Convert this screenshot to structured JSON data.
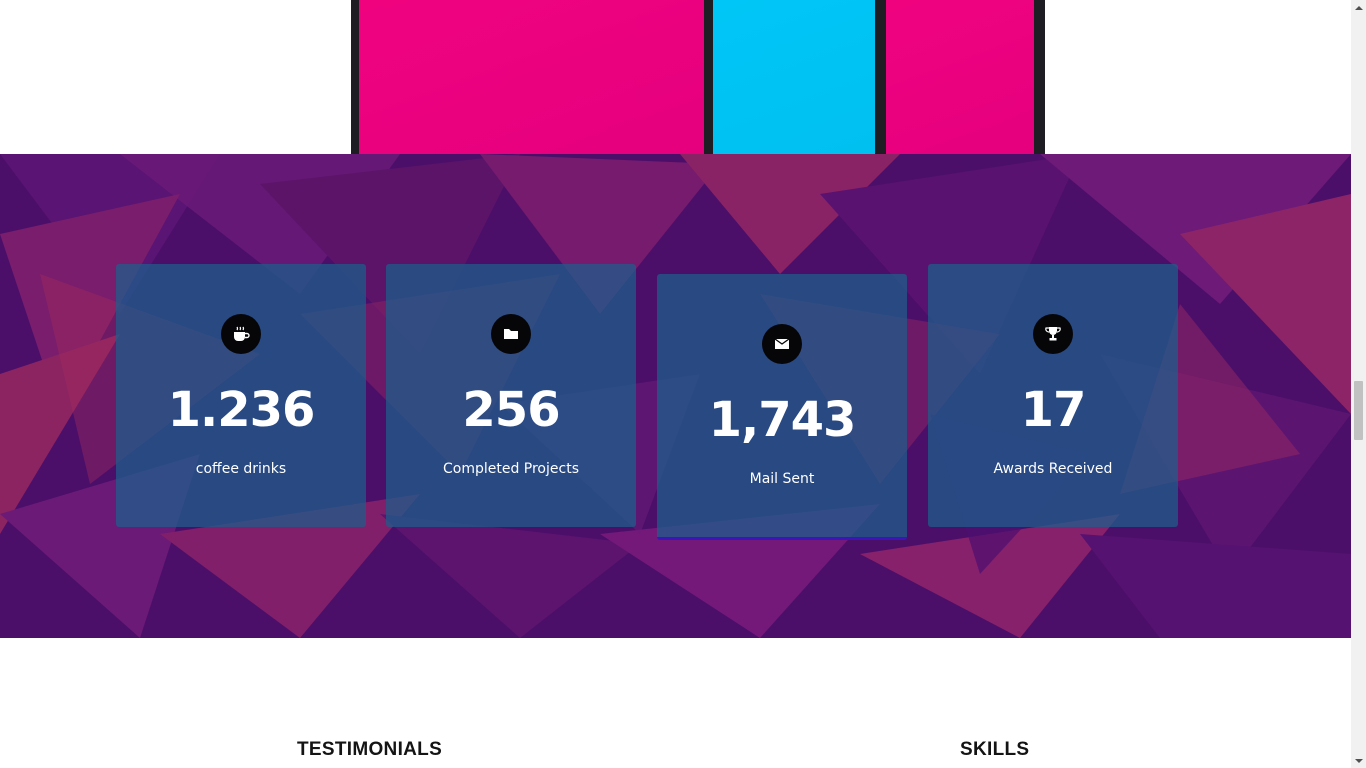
{
  "stats": [
    {
      "icon": "coffee-icon",
      "value": "1.236",
      "label": "coffee drinks"
    },
    {
      "icon": "folder-icon",
      "value": "256",
      "label": "Completed Projects"
    },
    {
      "icon": "envelope-icon",
      "value": "1,743",
      "label": "Mail Sent"
    },
    {
      "icon": "trophy-icon",
      "value": "17",
      "label": "Awards Received"
    }
  ],
  "sections": {
    "testimonials_title": "TESTIMONIALS",
    "skills_title": "SKILLS"
  },
  "colors": {
    "accent_pink": "#f0027f",
    "accent_cyan": "#00c6f7",
    "band_purple": "#4a0f6b",
    "card_blue": "#1b5f8c"
  }
}
